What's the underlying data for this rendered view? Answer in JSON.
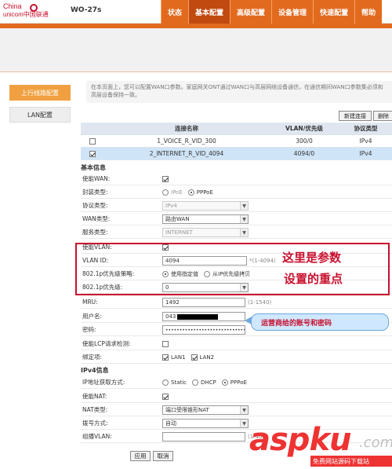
{
  "header": {
    "logo_en1": "China",
    "logo_en2": "unicom中国联通",
    "model": "WO-27s",
    "nav": [
      {
        "label": "状态",
        "active": false
      },
      {
        "label": "基本配置",
        "active": true
      },
      {
        "label": "高级配置",
        "active": false
      },
      {
        "label": "设备管理",
        "active": false
      },
      {
        "label": "快速配置",
        "active": false
      },
      {
        "label": "帮助",
        "active": false
      }
    ]
  },
  "sidebar": {
    "uplink": "上行线路配置",
    "lan": "LAN配置"
  },
  "info_text": "在本页面上，您可以配置WAN口参数。家庭网关ONT通过WAN口与高层网络设备通信，在通信期间WAN口参数集必须和高层设备保持一致。",
  "toolbar": {
    "new": "新建连接",
    "delete": "删除"
  },
  "table": {
    "headers": [
      "连接名称",
      "VLAN/优先级",
      "协议类型"
    ],
    "rows": [
      {
        "checked": false,
        "name": "1_VOICE_R_VID_300",
        "vlan": "300/0",
        "proto": "IPv4"
      },
      {
        "checked": true,
        "name": "2_INTERNET_R_VID_4094",
        "vlan": "4094/0",
        "proto": "IPv4"
      }
    ]
  },
  "basic": {
    "section": "基本信息",
    "enable_wan_label": "使能WAN:",
    "encap_label": "封装类型:",
    "encap_ipoe": "IPoE",
    "encap_pppoe": "PPPoE",
    "proto_label": "协议类型:",
    "proto_value": "IPv4",
    "wan_type_label": "WAN类型:",
    "wan_type_value": "路由WAN",
    "service_label": "服务类型:",
    "service_value": "INTERNET",
    "enable_vlan_label": "使能VLAN:",
    "vlan_id_label": "VLAN ID:",
    "vlan_id_value": "4094",
    "vlan_id_hint": "*(1-4094)",
    "priority_policy_label": "802.1p优先级策略:",
    "policy_opt1": "使用指定值",
    "policy_opt2": "从IP优先级拷贝",
    "priority_label": "802.1p优先级:",
    "priority_value": "0",
    "mru_label": "MRU:",
    "mru_value": "1492",
    "mru_hint": "(1-1540)",
    "user_label": "用户名:",
    "user_value": "043",
    "pass_label": "密码:",
    "pass_value": "•••••••••••••••••••••••••••••••••••••••",
    "lcp_label": "使能LCP请求检测:",
    "bind_label": "绑定项:",
    "bind_lan1": "LAN1",
    "bind_lan2": "LAN2"
  },
  "ipv4": {
    "section": "IPv4信息",
    "ip_mode_label": "IP地址获取方式:",
    "ip_static": "Static",
    "ip_dhcp": "DHCP",
    "ip_pppoe": "PPPoE",
    "nat_enable_label": "使能NAT:",
    "nat_type_label": "NAT类型:",
    "nat_type_value": "端口受限锥形NAT",
    "dial_label": "拨号方式:",
    "dial_value": "自动",
    "mcast_label": "组播VLAN:",
    "mcast_hint": "(1-40"
  },
  "annotation": {
    "line1": "这里是参数",
    "line2": "设置的重点",
    "callout": "运营商给的账号和密码"
  },
  "buttons": {
    "apply": "应用",
    "cancel": "取消"
  },
  "watermark": {
    "main_a": "asp",
    "main_b": "ku",
    "dot": ".com",
    "sub": "免费网站源码下载站"
  }
}
